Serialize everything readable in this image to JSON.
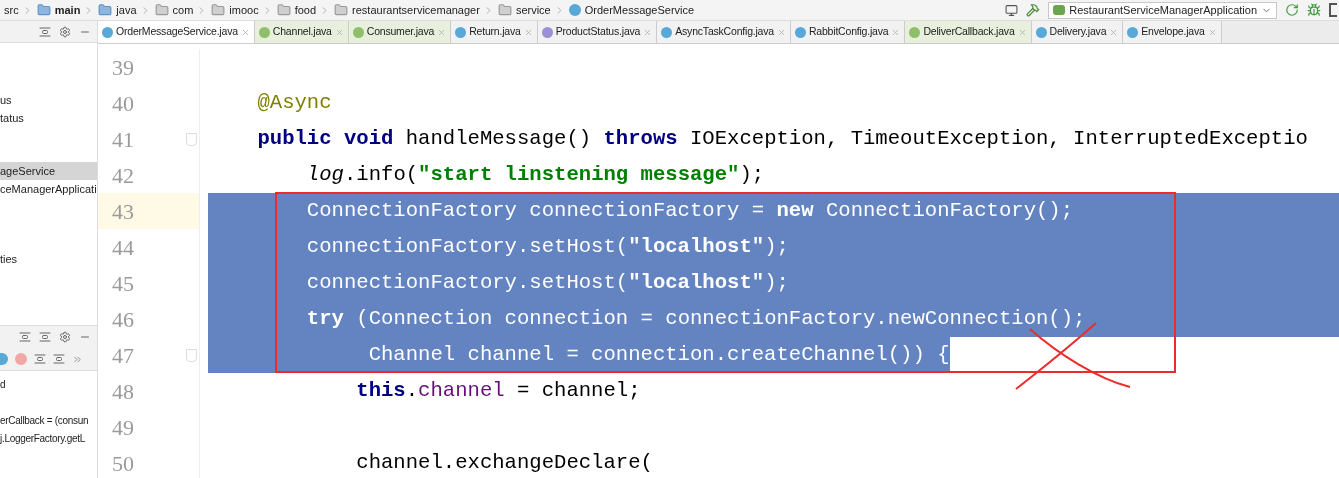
{
  "breadcrumb": [
    {
      "label": "src",
      "kind": "plain"
    },
    {
      "label": "main",
      "kind": "source"
    },
    {
      "label": "java",
      "kind": "source"
    },
    {
      "label": "com",
      "kind": "package"
    },
    {
      "label": "imooc",
      "kind": "package"
    },
    {
      "label": "food",
      "kind": "package"
    },
    {
      "label": "restaurantservicemanager",
      "kind": "package"
    },
    {
      "label": "service",
      "kind": "package"
    },
    {
      "label": "OrderMessageService",
      "kind": "class"
    }
  ],
  "run_config": {
    "label": "RestaurantServiceManagerApplication"
  },
  "tabs": [
    {
      "label": "OrderMessageService.java",
      "kind": "class",
      "selected": true
    },
    {
      "label": "Channel.java",
      "kind": "interface",
      "selected": false
    },
    {
      "label": "Consumer.java",
      "kind": "interface",
      "selected": false
    },
    {
      "label": "Return.java",
      "kind": "class",
      "selected": false
    },
    {
      "label": "ProductStatus.java",
      "kind": "enum",
      "selected": false
    },
    {
      "label": "AsyncTaskConfig.java",
      "kind": "class",
      "selected": false
    },
    {
      "label": "RabbitConfig.java",
      "kind": "class",
      "selected": false
    },
    {
      "label": "DeliverCallback.java",
      "kind": "interface",
      "selected": false
    },
    {
      "label": "Delivery.java",
      "kind": "class",
      "selected": false
    },
    {
      "label": "Envelope.java",
      "kind": "class",
      "selected": false
    }
  ],
  "project_tree": [
    {
      "label": "us",
      "selected": false
    },
    {
      "label": "tatus",
      "selected": false
    },
    {
      "label": "ageService",
      "selected": true
    },
    {
      "label": "ceManagerApplicati",
      "selected": false
    },
    {
      "label": "ties",
      "selected": false
    }
  ],
  "structure_panel": [
    "d",
    "erCallback = (consun",
    "j.LoggerFactory.getL"
  ],
  "editor": {
    "lines": [
      {
        "number": "39",
        "current": false,
        "fold": false,
        "selected": false
      },
      {
        "number": "40",
        "current": false,
        "fold": false,
        "selected": false,
        "segments": [
          {
            "text": "    @Async",
            "kind": "annotation"
          }
        ]
      },
      {
        "number": "41",
        "current": false,
        "fold": true,
        "selected": false,
        "segments": [
          {
            "text": "    public void",
            "kind": "keyword"
          },
          {
            "text": " handleMessage() ",
            "kind": "plain"
          },
          {
            "text": "throws",
            "kind": "keyword"
          },
          {
            "text": " IOException, TimeoutException, InterruptedExceptio",
            "kind": "plain"
          }
        ]
      },
      {
        "number": "42",
        "current": false,
        "fold": false,
        "selected": false,
        "segments": [
          {
            "text": "        log",
            "kind": "static"
          },
          {
            "text": ".info(",
            "kind": "plain"
          },
          {
            "text": "\"start linstening message\"",
            "kind": "string"
          },
          {
            "text": ");",
            "kind": "plain"
          }
        ]
      },
      {
        "number": "43",
        "current": true,
        "fold": false,
        "selected": true,
        "full_width": true,
        "segments": [
          {
            "text": "        ConnectionFactory connectionFactory = ",
            "kind": "plain"
          },
          {
            "text": "new",
            "kind": "keyword"
          },
          {
            "text": " ConnectionFactory();",
            "kind": "plain"
          }
        ]
      },
      {
        "number": "44",
        "current": false,
        "fold": false,
        "selected": true,
        "full_width": true,
        "segments": [
          {
            "text": "        connectionFactory.setHost(",
            "kind": "plain"
          },
          {
            "text": "\"localhost\"",
            "kind": "string"
          },
          {
            "text": ");",
            "kind": "plain"
          }
        ]
      },
      {
        "number": "45",
        "current": false,
        "fold": false,
        "selected": true,
        "full_width": true,
        "segments": [
          {
            "text": "        connectionFactory.setHost(",
            "kind": "plain"
          },
          {
            "text": "\"localhost\"",
            "kind": "string"
          },
          {
            "text": ");",
            "kind": "plain"
          }
        ]
      },
      {
        "number": "46",
        "current": false,
        "fold": false,
        "selected": true,
        "full_width": true,
        "segments": [
          {
            "text": "        try",
            "kind": "keyword"
          },
          {
            "text": " (Connection connection = connectionFactory.newConnection();",
            "kind": "plain"
          }
        ]
      },
      {
        "number": "47",
        "current": false,
        "fold": true,
        "selected": true,
        "full_width": false,
        "segments": [
          {
            "text": "             Channel channel = connection.createChannel()) {",
            "kind": "plain"
          }
        ]
      },
      {
        "number": "48",
        "current": false,
        "fold": false,
        "selected": false,
        "segments": [
          {
            "text": "            this",
            "kind": "keyword"
          },
          {
            "text": ".",
            "kind": "plain"
          },
          {
            "text": "channel",
            "kind": "field"
          },
          {
            "text": " = channel;",
            "kind": "plain"
          }
        ]
      },
      {
        "number": "49",
        "current": false,
        "fold": false,
        "selected": false
      },
      {
        "number": "50",
        "current": false,
        "fold": false,
        "selected": false,
        "segments": [
          {
            "text": "            channel.exchangeDeclare(",
            "kind": "plain"
          }
        ]
      }
    ]
  }
}
